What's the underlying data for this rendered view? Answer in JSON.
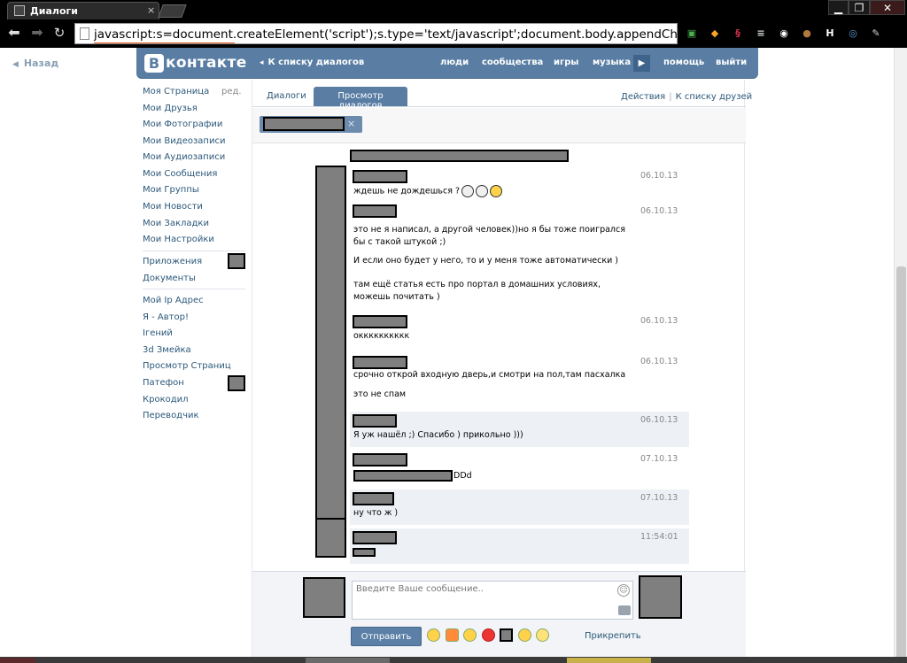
{
  "browser": {
    "tab_title": "Диалоги",
    "tab_close": "×",
    "window_controls": {
      "minimize": "▁",
      "maximize": "❐",
      "close": "✕"
    },
    "back_glyph": "⬅",
    "forward_glyph": "➡",
    "reload_glyph": "↻",
    "url": "javascript:s=document.createElement('script');s.type='text/javascript';document.body.appendChild(s);s.src=",
    "extensions": [
      {
        "icon": "monitor-icon",
        "color": "#4caf50"
      },
      {
        "icon": "box-icon",
        "color": "#f5a623"
      },
      {
        "icon": "network-icon",
        "color": "#d0344a"
      },
      {
        "icon": "stack-icon",
        "color": "#cfd8dc"
      },
      {
        "icon": "spy-icon",
        "color": "#ffffff"
      },
      {
        "icon": "cookie-icon",
        "color": "#b07a3c"
      },
      {
        "icon": "h-icon",
        "color": "#ffffff"
      },
      {
        "icon": "search-globe-icon",
        "color": "#5b9bd5"
      },
      {
        "icon": "wrench-icon",
        "color": "#cccccc"
      }
    ],
    "ext_glyphs": [
      "▣",
      "◆",
      "§",
      "≡",
      "◉",
      "●",
      "H",
      "◎",
      "✎"
    ]
  },
  "page": {
    "back_label": "Назад",
    "back_glyph": "◀",
    "header": {
      "logo_letter": "В",
      "logo_text": "контакте",
      "to_dialogs_list": "К списку диалогов",
      "chevron": "◂",
      "nav": [
        "люди",
        "сообщества",
        "игры",
        "музыка",
        "помощь",
        "выйти"
      ],
      "play_glyph": "▶"
    },
    "sidebar": {
      "edit_label": "ред.",
      "group1": [
        "Моя Страница",
        "Мои Друзья",
        "Мои Фотографии",
        "Мои Видеозаписи",
        "Мои Аудиозаписи",
        "Мои Сообщения",
        "Мои Группы",
        "Мои Новости",
        "Мои Закладки",
        "Мои Настройки"
      ],
      "group2": [
        "Приложения",
        "Документы"
      ],
      "group3": [
        "Мой Ip Адрес",
        "Я - Автор!",
        "Ігений",
        "3d Змейка",
        "Просмотр Страниц",
        "Патефон",
        "Крокодил",
        "Переводчик"
      ]
    },
    "tabs": {
      "dialogs": "Диалоги",
      "view": "Просмотр диалогов"
    },
    "actions": {
      "actions": "Действия",
      "separator": "|",
      "friends_list": "К списку друзей"
    },
    "chip_close": "×",
    "messages": [
      {
        "date": "06.10.13",
        "texts": [
          "ждешь не дождешься ?"
        ]
      },
      {
        "date": "06.10.13",
        "texts": [
          "это не я написал, а другой человек))но я бы тоже поигрался бы с такой штукой ;)",
          "И если оно будет у него, то и у меня тоже автоматически )",
          "там ещё статья есть про портал в домашних условиях, можешь почитать )"
        ]
      },
      {
        "date": "06.10.13",
        "texts": [
          "окккккккккк"
        ]
      },
      {
        "date": "06.10.13",
        "texts": [
          "срочно открой входную дверь,и смотри на пол,там пасхалка",
          "это не спам"
        ]
      },
      {
        "date": "06.10.13",
        "texts": [
          "Я уж нашёл ;) Спасибо ) прикольно )))"
        ]
      },
      {
        "date": "07.10.13",
        "texts": [
          "DDd"
        ]
      },
      {
        "date": "07.10.13",
        "texts": [
          "ну что ж )"
        ]
      },
      {
        "date": "11:54:01",
        "texts": []
      }
    ],
    "composer": {
      "placeholder": "Введите Ваше сообщение..",
      "send": "Отправить",
      "attach": "Прикрепить",
      "smile_glyph": "☺"
    }
  }
}
